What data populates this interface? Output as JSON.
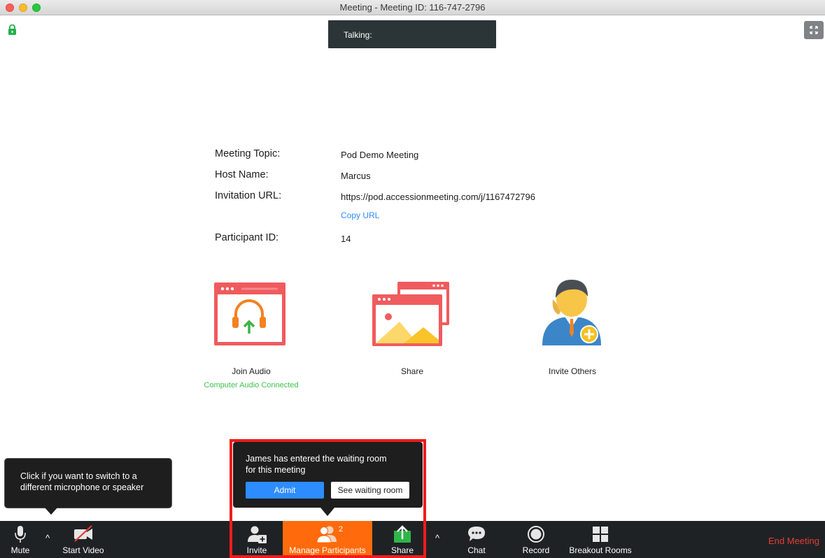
{
  "window": {
    "title": "Meeting - Meeting ID: 116-747-2796"
  },
  "talking": {
    "label": "Talking:"
  },
  "info": {
    "topic_label": "Meeting Topic:",
    "topic_value": "Pod Demo Meeting",
    "host_label": "Host Name:",
    "host_value": "Marcus",
    "url_label": "Invitation URL:",
    "url_value": "https://pod.accessionmeeting.com/j/1167472796",
    "copy_url": "Copy URL",
    "participant_label": "Participant ID:",
    "participant_value": "14"
  },
  "actions": {
    "join_audio": "Join Audio",
    "audio_status": "Computer Audio Connected",
    "share": "Share",
    "invite_others": "Invite Others"
  },
  "mic_tip": {
    "line1": "Click if you want to switch to a",
    "line2": "different microphone or speaker"
  },
  "waiting_room": {
    "line1": "James has entered the waiting room",
    "line2": "for this meeting",
    "admit": "Admit",
    "see": "See waiting room"
  },
  "toolbar": {
    "mute": "Mute",
    "start_video": "Start Video",
    "invite": "Invite",
    "manage_participants": "Manage Participants",
    "participant_count": "2",
    "share": "Share",
    "chat": "Chat",
    "record": "Record",
    "breakout_rooms": "Breakout Rooms",
    "end_meeting": "End Meeting"
  },
  "colors": {
    "accent_blue": "#2d8cff",
    "manage_orange": "#ff6b0c",
    "end_red": "#e53d35",
    "status_green": "#3fc24e",
    "highlight_red": "#ee1c1c"
  }
}
